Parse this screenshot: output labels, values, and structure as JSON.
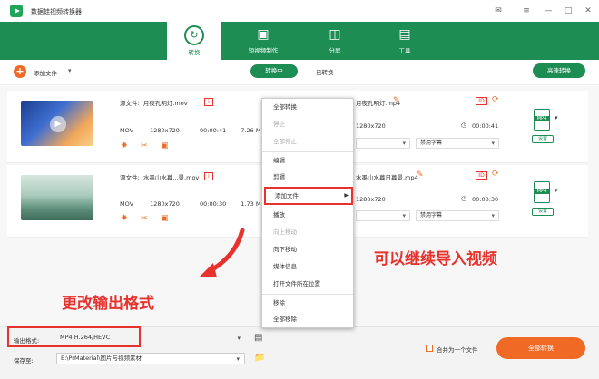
{
  "app": {
    "title": "数据蛙视频转换器"
  },
  "nav": {
    "tabs": [
      {
        "label": "转换"
      },
      {
        "label": "短视频制作"
      },
      {
        "label": "分屏"
      },
      {
        "label": "工具"
      }
    ]
  },
  "toolbar": {
    "add_label": "添加文件",
    "tab_converting": "转换中",
    "tab_converted": "已转换",
    "fast_label": "高速转换"
  },
  "files": [
    {
      "source_label": "源文件:",
      "source_name": "月夜孔明灯.mov",
      "format": "MOV",
      "resolution": "1280x720",
      "duration": "00:00:41",
      "size": "7.26 MB",
      "output_name": "月夜孔明灯.mp4",
      "out_resolution": "1280x720",
      "out_duration": "00:00:41",
      "subtitle": "禁用字幕",
      "format_icon": "MP4",
      "settings": "设置"
    },
    {
      "source_label": "源文件:",
      "source_name": "水墨山水暮...景.mov",
      "format": "MOV",
      "resolution": "1280x720",
      "duration": "00:00:30",
      "size": "1.73 MB",
      "output_name": "水墨山水暮日暮景.mp4",
      "out_resolution": "1280x720",
      "out_duration": "00:00:30",
      "subtitle": "禁用字幕",
      "format_icon": "MP4",
      "settings": "设置"
    }
  ],
  "context_menu": {
    "items": [
      "全部转换",
      "停止",
      "全部停止",
      "编辑",
      "剪辑",
      "添加文件",
      "播放",
      "向上移动",
      "向下移动",
      "媒体信息",
      "打开文件所在位置",
      "移除",
      "全部移除"
    ]
  },
  "bottom": {
    "output_format_label": "输出格式:",
    "output_format_value": "MP4 H.264/HEVC",
    "save_label": "保存至:",
    "save_path": "E:\\PrMaterial\\图片与视频素材",
    "merge_label": "合并为一个文件",
    "convert_all": "全部转换"
  },
  "annotations": {
    "hint_import": "可以继续导入视频",
    "hint_format": "更改输出格式"
  },
  "colors": {
    "brand_green": "#1e8d53",
    "accent_orange": "#f06a25",
    "annotation_red": "#e8322d"
  }
}
